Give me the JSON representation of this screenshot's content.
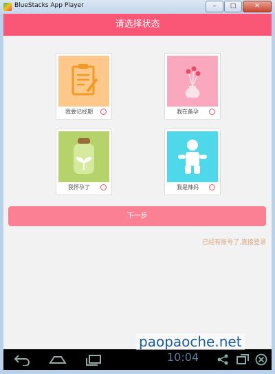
{
  "window": {
    "title": "BlueStacks App Player",
    "btn_min": "–",
    "btn_max": "□",
    "btn_close": "✕"
  },
  "header": {
    "title": "请选择状态"
  },
  "options": [
    {
      "label": "我要记经期",
      "icon": "clipboard-icon",
      "color": "#fdc889"
    },
    {
      "label": "我在备孕",
      "icon": "flower-vase-icon",
      "color": "#f9a8bd"
    },
    {
      "label": "我怀孕了",
      "icon": "sprout-jar-icon",
      "color": "#b5d36a"
    },
    {
      "label": "我是辣妈",
      "icon": "baby-icon",
      "color": "#4ed8e9"
    }
  ],
  "next_button": {
    "label": "下一步"
  },
  "login_link": {
    "label": "已经有账号了,直接登录"
  },
  "statusbar": {
    "time": "10:04"
  },
  "watermark": {
    "text": "paopaoche.net"
  },
  "colors": {
    "accent": "#fa5676",
    "button": "#fb8094",
    "link": "#d8a882"
  }
}
